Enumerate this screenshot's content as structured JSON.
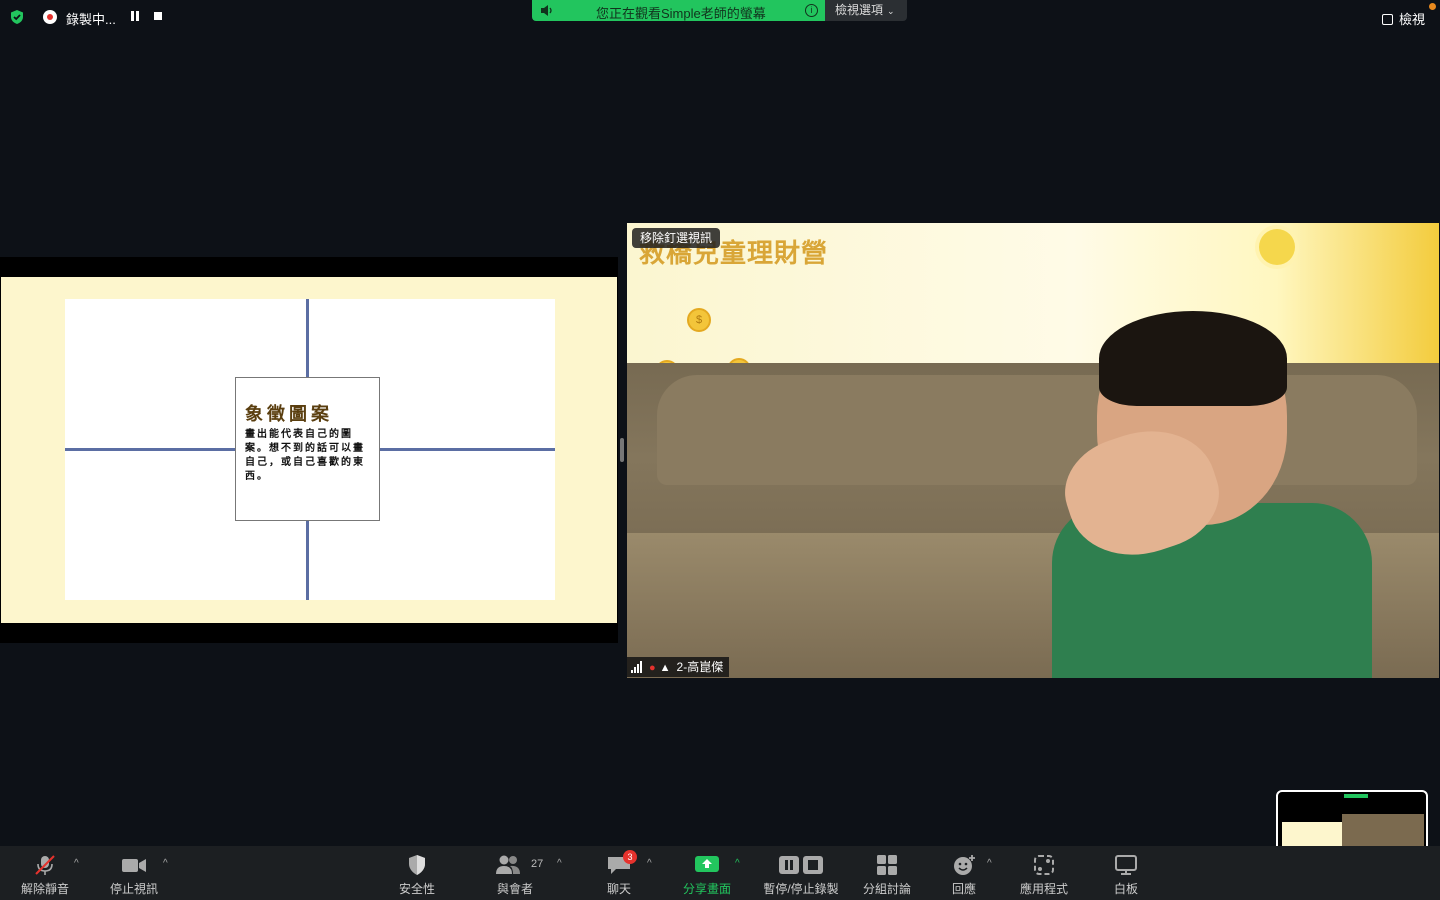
{
  "top_bar": {
    "recording_label": "錄製中...",
    "banner_text": "您正在觀看Simple老師的螢幕",
    "banner_info": "i",
    "view_options_label": "檢視選項",
    "view_label": "檢視"
  },
  "slide": {
    "title": "象徵圖案",
    "body": "畫出能代表自己的圖案。想不到的話可以畫自己，或自己喜歡的東西。"
  },
  "video": {
    "unpin_label": "移除釘選視訊",
    "background_title": "救橋兒童理財營",
    "coin_symbol": "$",
    "participant_name": "2-高崑傑"
  },
  "toolbar": {
    "items": [
      {
        "label": "解除靜音",
        "icon": "mic-muted-icon"
      },
      {
        "label": "停止視訊",
        "icon": "video-camera-icon"
      },
      {
        "label": "安全性",
        "icon": "shield-icon"
      },
      {
        "label": "與會者",
        "icon": "participants-icon",
        "count": "27"
      },
      {
        "label": "聊天",
        "icon": "chat-icon",
        "badge": "3"
      },
      {
        "label": "分享畫面",
        "icon": "share-screen-icon"
      },
      {
        "label": "暫停/停止錄製",
        "icon": "pause-stop-record-icon"
      },
      {
        "label": "分組討論",
        "icon": "breakout-rooms-icon"
      },
      {
        "label": "回應",
        "icon": "reactions-icon"
      },
      {
        "label": "應用程式",
        "icon": "apps-icon"
      },
      {
        "label": "白板",
        "icon": "whiteboard-icon"
      }
    ],
    "caret": "^"
  },
  "colors": {
    "accent_green": "#22c55e",
    "recording_red": "#e5322d",
    "toolbar_bg": "#1c1f22",
    "page_bg": "#0d1117"
  }
}
